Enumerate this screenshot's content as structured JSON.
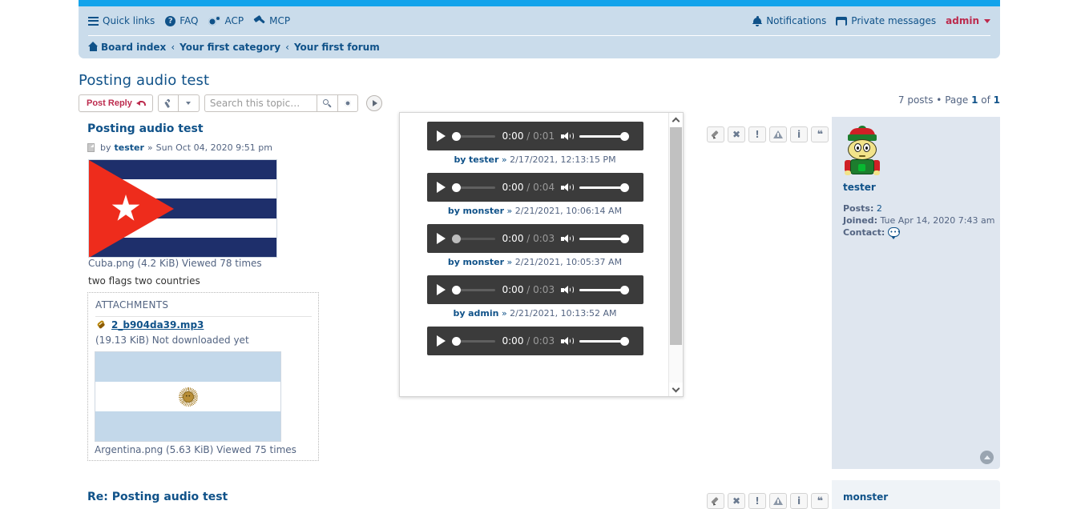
{
  "nav": {
    "quick_links": "Quick links",
    "faq": "FAQ",
    "acp": "ACP",
    "mcp": "MCP",
    "notifications": "Notifications",
    "private_messages": "Private messages",
    "username": "admin"
  },
  "breadcrumb": {
    "board_index": "Board index",
    "sep1": "‹",
    "category": "Your first category",
    "sep2": "‹",
    "forum": "Your first forum"
  },
  "topic": {
    "title": "Posting audio test",
    "post_reply": "Post Reply",
    "search_placeholder": "Search this topic…",
    "search_value": "",
    "post_count_text": "7 posts • Page ",
    "page_current": "1",
    "page_of": " of ",
    "page_total": "1"
  },
  "post1": {
    "subject": "Posting audio test",
    "by_label": "by",
    "author": "tester",
    "date_sep": "»",
    "date": "Sun Oct 04, 2020 9:51 pm",
    "image1_caption": "Cuba.png (4.2 KiB) Viewed 78 times",
    "body_text": "two flags two countries",
    "attachments_title": "ATTACHMENTS",
    "attachment_name": "2_b904da39.mp3",
    "attachment_meta": "(19.13 KiB) Not downloaded yet",
    "image2_caption": "Argentina.png (5.63 KiB) Viewed 75 times",
    "actions": [
      {
        "name": "edit-post-button",
        "glyph": "pencil"
      },
      {
        "name": "delete-post-button",
        "glyph": "x"
      },
      {
        "name": "report-post-button",
        "glyph": "bang"
      },
      {
        "name": "warn-user-button",
        "glyph": "warn"
      },
      {
        "name": "post-info-button",
        "glyph": "info"
      },
      {
        "name": "quote-post-button",
        "glyph": "quote"
      }
    ],
    "profile": {
      "username": "tester",
      "posts_label": "Posts:",
      "posts_value": "2",
      "joined_label": "Joined:",
      "joined_value": "Tue Apr 14, 2020 7:43 am",
      "contact_label": "Contact:"
    }
  },
  "post2": {
    "subject": "Re: Posting audio test",
    "author": "monster"
  },
  "audio_overlay": {
    "items": [
      {
        "current_time": "0:00",
        "separator": " / ",
        "duration": "0:01",
        "by_label": "by",
        "author": "tester",
        "date_sep": "»",
        "date": "2/17/2021, 12:13:15 PM",
        "seek_dim": false
      },
      {
        "current_time": "0:00",
        "separator": " / ",
        "duration": "0:04",
        "by_label": "by",
        "author": "monster",
        "date_sep": "»",
        "date": "2/21/2021, 10:06:14 AM",
        "seek_dim": false
      },
      {
        "current_time": "0:00",
        "separator": " / ",
        "duration": "0:03",
        "by_label": "by",
        "author": "monster",
        "date_sep": "»",
        "date": "2/21/2021, 10:05:37 AM",
        "seek_dim": true
      },
      {
        "current_time": "0:00",
        "separator": " / ",
        "duration": "0:03",
        "by_label": "by",
        "author": "admin",
        "date_sep": "»",
        "date": "2/21/2021, 10:13:52 AM",
        "seek_dim": false
      },
      {
        "current_time": "0:00",
        "separator": " / ",
        "duration": "0:03",
        "by_label": "",
        "author": "",
        "date_sep": "",
        "date": "",
        "seek_dim": false
      }
    ]
  },
  "colors": {
    "brand_blue": "#12a3eb",
    "nav_bg": "#cadceb",
    "link": "#105289",
    "accent_red": "#bc2a4d",
    "post_bg": "#dfe6ef",
    "player_bg": "#3b3b3b",
    "text": "#536482"
  }
}
